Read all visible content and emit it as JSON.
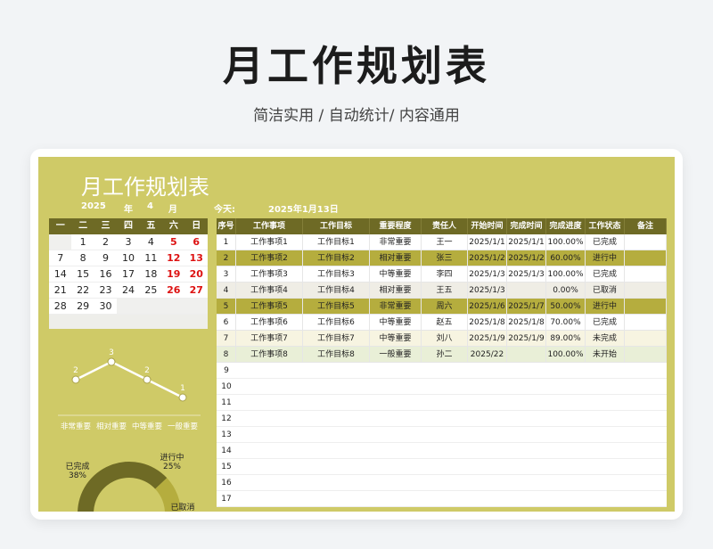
{
  "hero": {
    "title": "月工作规划表",
    "subtitle": "简洁实用 / 自动统计/ 内容通用"
  },
  "sheet": {
    "title": "月工作规划表",
    "year": "2025",
    "year_unit": "年",
    "month": "4",
    "month_unit": "月",
    "today_label": "今天:",
    "today_value": "2025年1月13日"
  },
  "calendar": {
    "weekdays": [
      "一",
      "二",
      "三",
      "四",
      "五",
      "六",
      "日"
    ],
    "weeks": [
      [
        "",
        "1",
        "2",
        "3",
        "4",
        "5",
        "6"
      ],
      [
        "7",
        "8",
        "9",
        "10",
        "11",
        "12",
        "13"
      ],
      [
        "14",
        "15",
        "16",
        "17",
        "18",
        "19",
        "20"
      ],
      [
        "21",
        "22",
        "23",
        "24",
        "25",
        "26",
        "27"
      ],
      [
        "28",
        "29",
        "30",
        "",
        "",
        "",
        ""
      ]
    ]
  },
  "table": {
    "headers": [
      "序号",
      "工作事项",
      "工作目标",
      "重要程度",
      "责任人",
      "开始时间",
      "完成时间",
      "完成进度",
      "工作状态",
      "备注"
    ],
    "rows": [
      [
        "1",
        "工作事项1",
        "工作目标1",
        "非常重要",
        "王一",
        "2025/1/1",
        "2025/1/1",
        "100.00%",
        "已完成",
        ""
      ],
      [
        "2",
        "工作事项2",
        "工作目标2",
        "相对重要",
        "张三",
        "2025/1/2",
        "2025/1/2",
        "60.00%",
        "进行中",
        ""
      ],
      [
        "3",
        "工作事项3",
        "工作目标3",
        "中等重要",
        "李四",
        "2025/1/3",
        "2025/1/3",
        "100.00%",
        "已完成",
        ""
      ],
      [
        "4",
        "工作事项4",
        "工作目标4",
        "相对重要",
        "王五",
        "2025/1/3",
        "",
        "0.00%",
        "已取消",
        ""
      ],
      [
        "5",
        "工作事项5",
        "工作目标5",
        "非常重要",
        "周六",
        "2025/1/6",
        "2025/1/7",
        "50.00%",
        "进行中",
        ""
      ],
      [
        "6",
        "工作事项6",
        "工作目标6",
        "中等重要",
        "赵五",
        "2025/1/8",
        "2025/1/8",
        "70.00%",
        "已完成",
        ""
      ],
      [
        "7",
        "工作事项7",
        "工作目标7",
        "中等重要",
        "刘八",
        "2025/1/9",
        "2025/1/9",
        "89.00%",
        "未完成",
        ""
      ],
      [
        "8",
        "工作事项8",
        "工作目标8",
        "一般重要",
        "孙二",
        "2025/22",
        "",
        "100.00%",
        "未开始",
        ""
      ]
    ],
    "blank_numbers": [
      "9",
      "10",
      "11",
      "12",
      "13",
      "14",
      "15",
      "16",
      "17"
    ]
  },
  "chart_data": [
    {
      "type": "line",
      "categories": [
        "非常重要",
        "相对重要",
        "中等重要",
        "一般重要"
      ],
      "values": [
        2,
        3,
        2,
        1
      ],
      "ylim": [
        0,
        3
      ]
    },
    {
      "type": "pie",
      "categories": [
        "已完成",
        "进行中",
        "已取消"
      ],
      "values": [
        38,
        25,
        12
      ],
      "labels": [
        "已完成\n38%",
        "进行中\n25%",
        "已取消"
      ]
    }
  ],
  "colors": {
    "accent": "#cfca67",
    "header": "#6e6a25",
    "row_dark": "#b5ad3e",
    "weekend": "#d11111"
  }
}
